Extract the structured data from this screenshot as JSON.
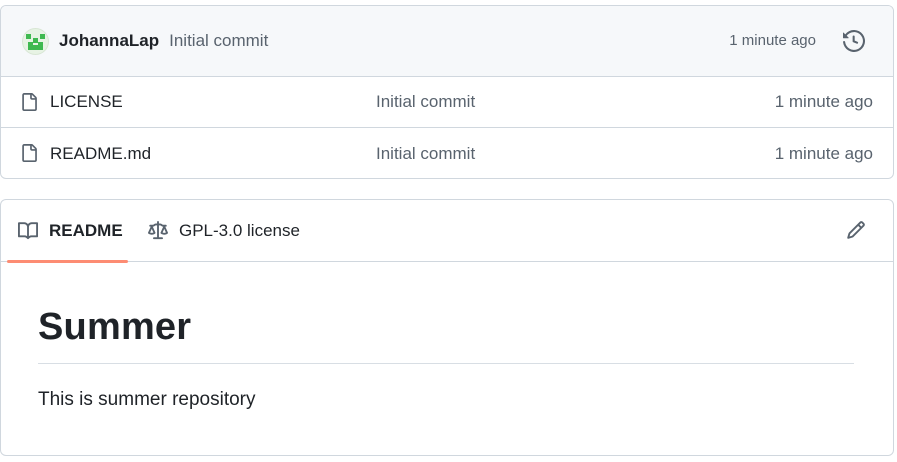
{
  "latest_commit": {
    "author": "JohannaLap",
    "message": "Initial commit",
    "time": "1 minute ago"
  },
  "files": [
    {
      "name": "LICENSE",
      "commit": "Initial commit",
      "time": "1 minute ago"
    },
    {
      "name": "README.md",
      "commit": "Initial commit",
      "time": "1 minute ago"
    }
  ],
  "readme_tabs": {
    "readme_label": "README",
    "license_label": "GPL-3.0 license"
  },
  "readme": {
    "title": "Summer",
    "text": "This is summer repository"
  },
  "colors": {
    "active_tab_underline": "#fd8c73",
    "avatar_green": "#3fb950"
  },
  "icons": {
    "history": "history-icon",
    "file": "file-icon",
    "book": "book-icon",
    "law": "law-icon",
    "edit": "pencil-icon"
  }
}
